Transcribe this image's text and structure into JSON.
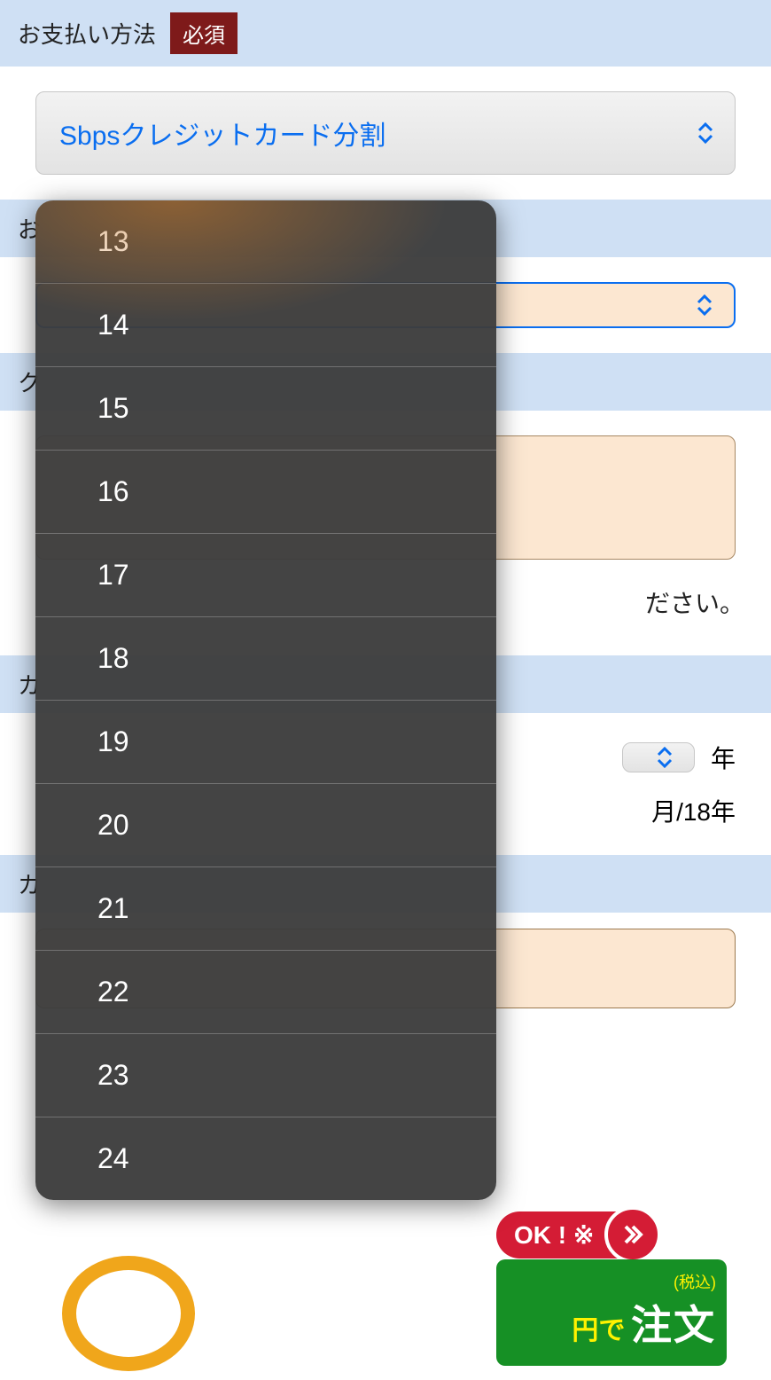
{
  "sections": {
    "payment_method": {
      "label": "お支払い方法",
      "required": "必須"
    },
    "installments": {
      "label_prefix": "お"
    },
    "card_number": {
      "label_prefix": "ク"
    },
    "expiry": {
      "label_prefix": "カ"
    },
    "card_name": {
      "label_prefix": "カ"
    }
  },
  "payment_method_select": {
    "value": "Sbpsクレジットカード分割"
  },
  "hint_tail": "ださい。",
  "expiry": {
    "year_label": "年",
    "example_tail": "月/18年"
  },
  "dropdown_options": [
    "13",
    "14",
    "15",
    "16",
    "17",
    "18",
    "19",
    "20",
    "21",
    "22",
    "23",
    "24"
  ],
  "banner": {
    "ok_text": "OK ! ※",
    "tax_text": "(税込)",
    "yen_de": "円で",
    "order": "注文"
  }
}
